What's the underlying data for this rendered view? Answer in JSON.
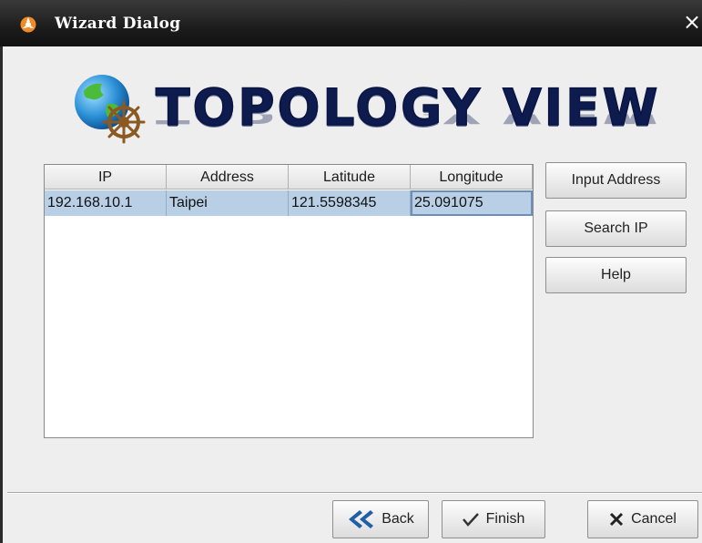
{
  "window": {
    "title": "Wizard Dialog",
    "close_glyph": "×"
  },
  "banner": {
    "text": "TOPOLOGY VIEW",
    "icon": "globe-with-helm-icon"
  },
  "table": {
    "columns": [
      "IP",
      "Address",
      "Latitude",
      "Longitude"
    ],
    "rows": [
      [
        "192.168.10.1",
        "Taipei",
        "121.5598345",
        "25.091075"
      ]
    ],
    "selected_row_color": "#b8cfe5"
  },
  "side_buttons": {
    "input_address": "Input Address",
    "search_ip": "Search IP",
    "help": "Help"
  },
  "footer": {
    "back": "Back",
    "finish": "Finish",
    "cancel": "Cancel",
    "back_icon_color": "#1f5fa8"
  }
}
